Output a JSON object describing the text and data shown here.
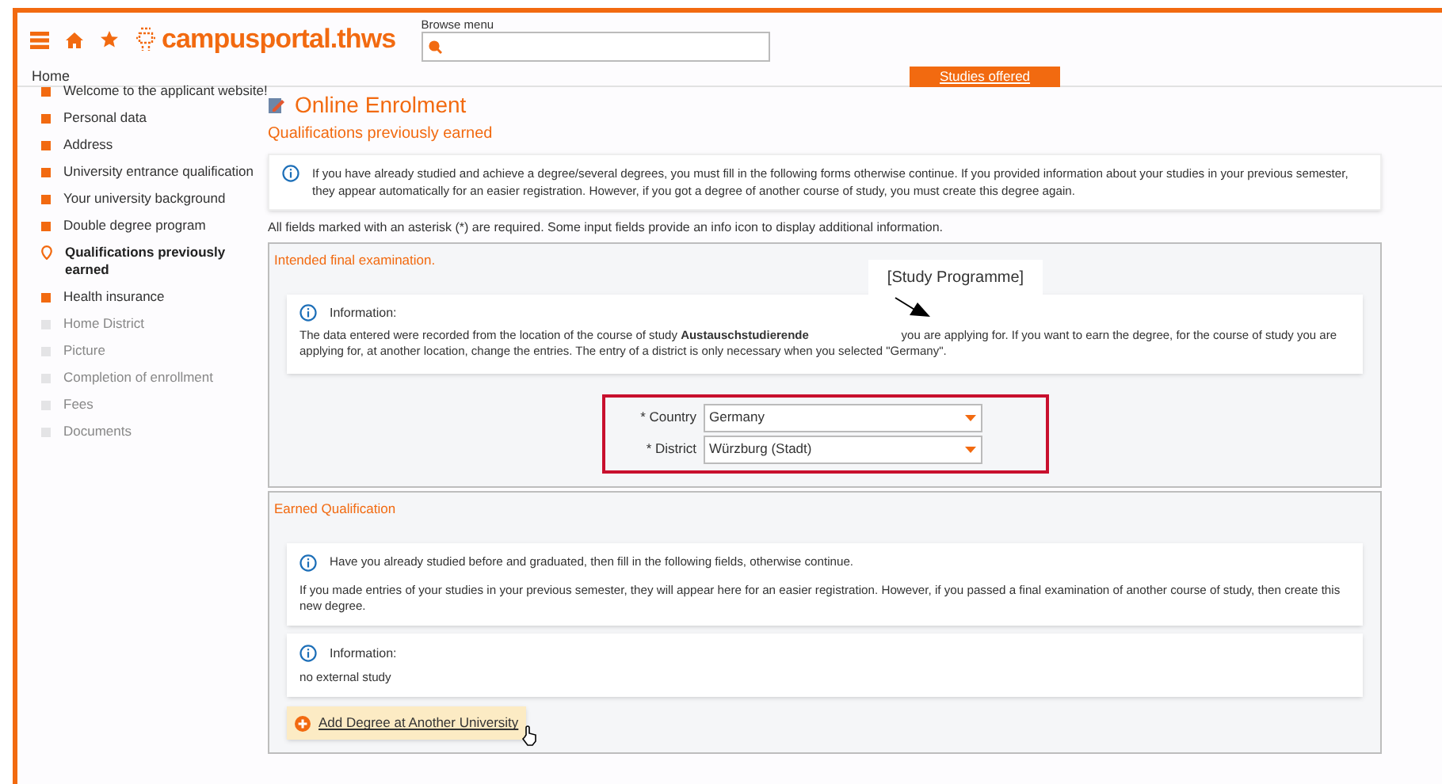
{
  "header": {
    "logo": "campusportal.thws",
    "search": {
      "label": "Browse menu"
    }
  },
  "nav": {
    "home": "Home",
    "studies_button": "Studies offered"
  },
  "sidebar": {
    "items": [
      {
        "label": "Welcome to the applicant website!",
        "kind": "done",
        "selected": false
      },
      {
        "label": "Personal data",
        "kind": "done",
        "selected": false
      },
      {
        "label": "Address",
        "kind": "done",
        "selected": false
      },
      {
        "label": "University entrance qualification",
        "kind": "done",
        "selected": false
      },
      {
        "label": "Your university background",
        "kind": "done",
        "selected": false
      },
      {
        "label": "Double degree program",
        "kind": "done",
        "selected": false
      },
      {
        "label": "Qualifications previously earned",
        "kind": "current",
        "selected": true
      },
      {
        "label": "Health insurance",
        "kind": "done",
        "selected": false
      },
      {
        "label": "Home District",
        "kind": "pending",
        "selected": false
      },
      {
        "label": "Picture",
        "kind": "pending",
        "selected": false
      },
      {
        "label": "Completion of enrollment",
        "kind": "pending",
        "selected": false
      },
      {
        "label": "Fees",
        "kind": "pending",
        "selected": false
      },
      {
        "label": "Documents",
        "kind": "pending",
        "selected": false
      }
    ]
  },
  "page": {
    "title": "Online Enrolment",
    "subtitle": "Qualifications previously earned",
    "intro": "If you have already studied and achieve a degree/several degrees, you must fill in the following forms otherwise continue. If you provided information about your studies in your previous semester, they appear automatically for an easier registration. However, if you got a degree of another course of study, you must create this degree again.",
    "required_note": "All fields marked with an asterisk (*) are required. Some input fields provide an info icon to display additional information."
  },
  "intended": {
    "title": "Intended final examination.",
    "info_title": "Information:",
    "info_text": "The data entered were recorded from the location of the course of study **Austauschstudierende**                            you are applying for. If you want to earn the degree, for the course of study you are applying for, at another location, change the entries. The entry of a district is only necessary when you selected \"Germany\".",
    "annotation": "[Study Programme]",
    "fields": [
      {
        "label": "* Country",
        "value": "Germany"
      },
      {
        "label": "* District",
        "value": "Würzburg (Stadt)"
      }
    ]
  },
  "earned": {
    "title": "Earned Qualification",
    "info_lines": [
      "Have you already studied before and graduated, then fill in the following fields, otherwise continue.",
      "If you made entries of your studies in your previous semester, they will appear here for an easier registration. However, if you passed a final examination of another course of study, then create this new degree."
    ],
    "info_title": "Information:",
    "info_text": "no external study",
    "add_button": "Add Degree at Another University"
  }
}
